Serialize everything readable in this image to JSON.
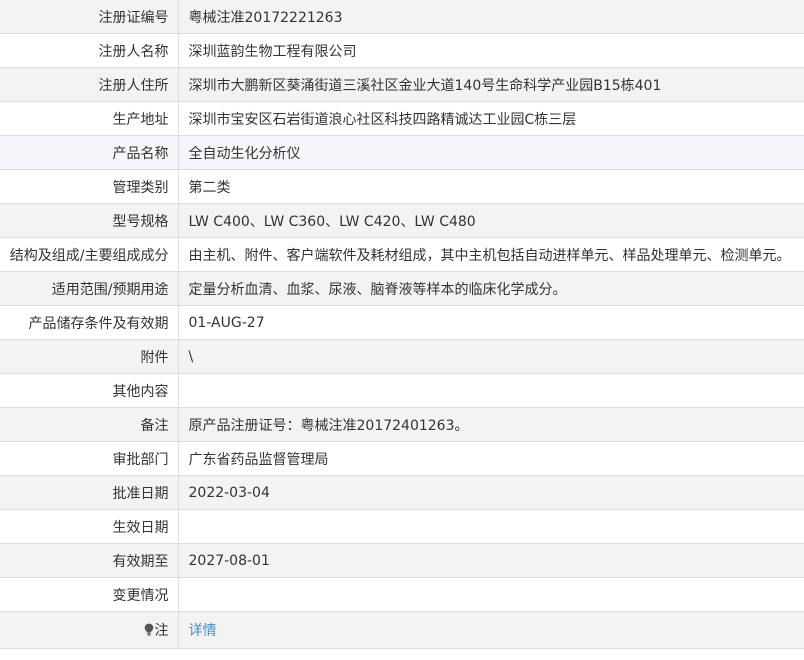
{
  "rows": [
    {
      "label": "注册证编号",
      "value": "粤械注准20172221263"
    },
    {
      "label": "注册人名称",
      "value": "深圳蓝韵生物工程有限公司"
    },
    {
      "label": "注册人住所",
      "value": "深圳市大鹏新区葵涌街道三溪社区金业大道140号生命科学产业园B15栋401"
    },
    {
      "label": "生产地址",
      "value": "深圳市宝安区石岩街道浪心社区科技四路精诚达工业园C栋三层"
    },
    {
      "label": "产品名称",
      "value": "全自动生化分析仪"
    },
    {
      "label": "管理类别",
      "value": "第二类"
    },
    {
      "label": "型号规格",
      "value": "LW C400、LW C360、LW C420、LW C480"
    },
    {
      "label": "结构及组成/主要组成成分",
      "value": "由主机、附件、客户端软件及耗材组成，其中主机包括自动进样单元、样品处理单元、检测单元。"
    },
    {
      "label": "适用范围/预期用途",
      "value": "定量分析血清、血浆、尿液、脑脊液等样本的临床化学成分。"
    },
    {
      "label": "产品储存条件及有效期",
      "value": "01-AUG-27"
    },
    {
      "label": "附件",
      "value": "\\"
    },
    {
      "label": "其他内容",
      "value": ""
    },
    {
      "label": "备注",
      "value": "原产品注册证号：粤械注准20172401263。"
    },
    {
      "label": "审批部门",
      "value": "广东省药品监督管理局"
    },
    {
      "label": "批准日期",
      "value": "2022-03-04"
    },
    {
      "label": "生效日期",
      "value": ""
    },
    {
      "label": "有效期至",
      "value": "2027-08-01"
    },
    {
      "label": "变更情况",
      "value": ""
    }
  ],
  "note_row": {
    "icon": "lightbulb-icon",
    "label": "注",
    "link_text": "详情"
  },
  "colors": {
    "link": "#3a8fd9",
    "row_alt": "#f3f3f3",
    "row_highlight": "#f5f6fa",
    "border": "#dddddd"
  }
}
